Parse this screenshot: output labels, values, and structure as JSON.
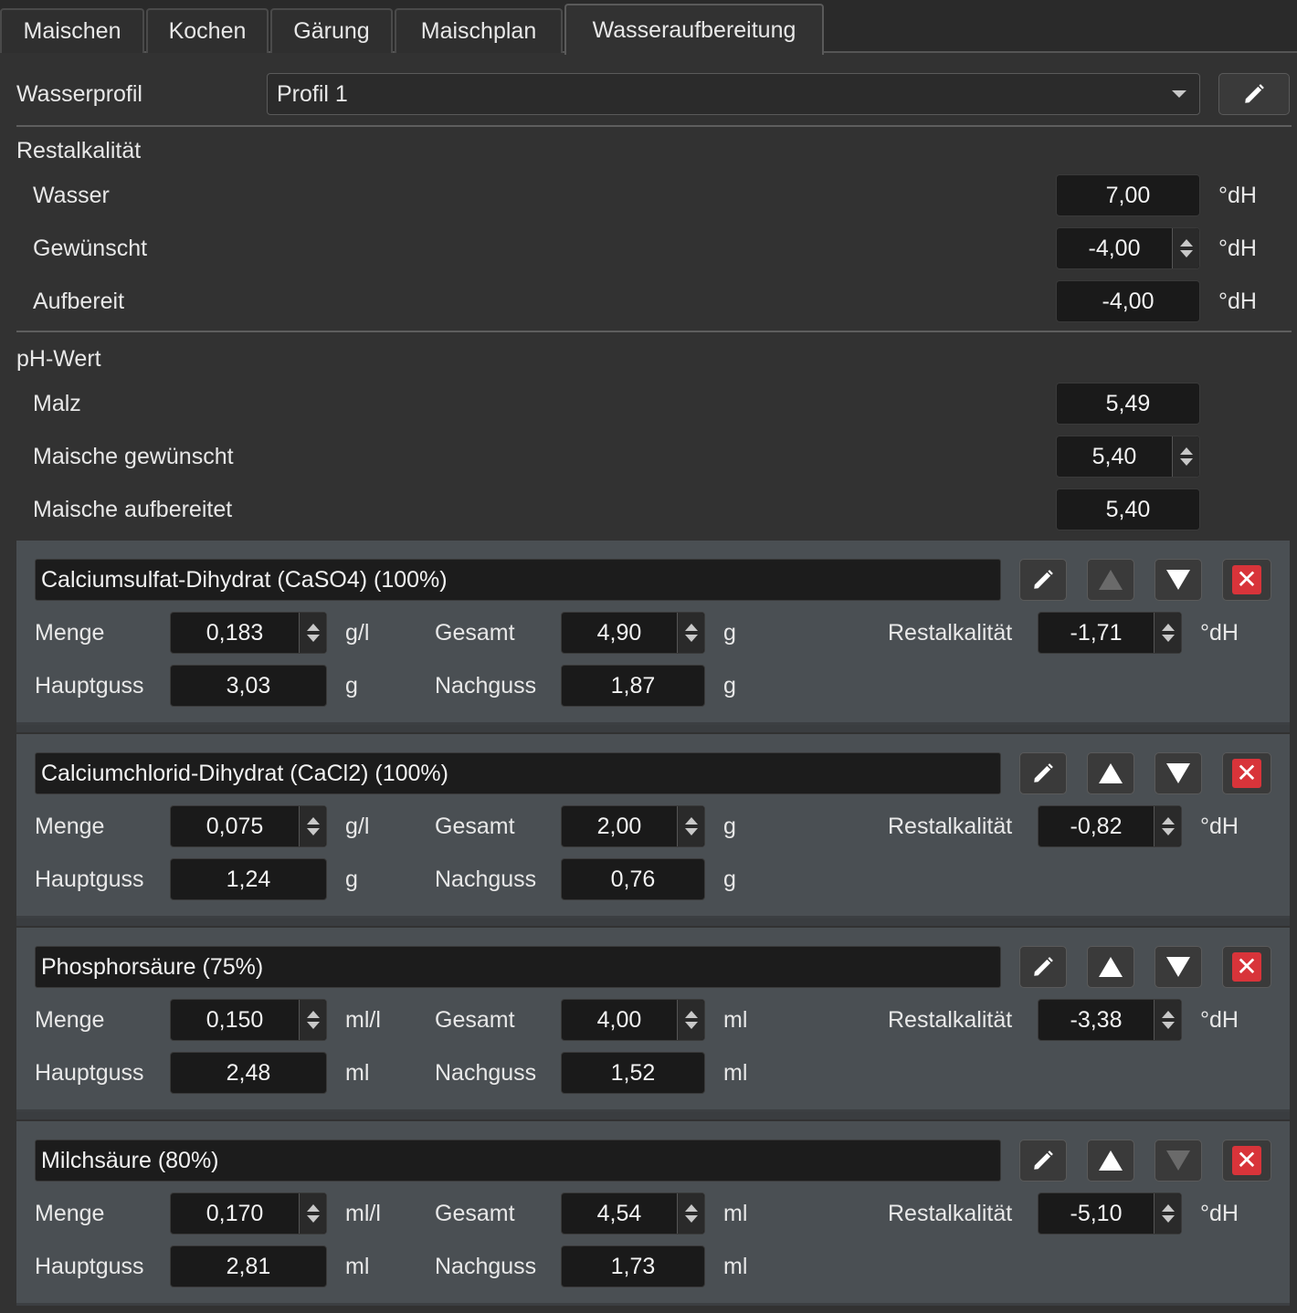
{
  "tabs": [
    "Maischen",
    "Kochen",
    "Gärung",
    "Maischplan",
    "Wasseraufbereitung"
  ],
  "profile": {
    "label": "Wasserprofil",
    "value": "Profil 1"
  },
  "restalkalitaet": {
    "heading": "Restalkalität",
    "rows": [
      {
        "label": "Wasser",
        "value": "7,00",
        "unit": "°dH"
      },
      {
        "label": "Gewünscht",
        "value": "-4,00",
        "unit": "°dH"
      },
      {
        "label": "Aufbereit",
        "value": "-4,00",
        "unit": "°dH"
      }
    ]
  },
  "ph": {
    "heading": "pH-Wert",
    "rows": [
      {
        "label": "Malz",
        "value": "5,49"
      },
      {
        "label": "Maische gewünscht",
        "value": "5,40"
      },
      {
        "label": "Maische aufbereitet",
        "value": "5,40"
      }
    ]
  },
  "field_labels": {
    "menge": "Menge",
    "gesamt": "Gesamt",
    "restalkalitaet": "Restalkalität",
    "hauptguss": "Hauptguss",
    "nachguss": "Nachguss",
    "ra_unit": "°dH"
  },
  "icons": {
    "edit": "pencil-icon",
    "up": "arrow-up-icon",
    "down": "arrow-down-icon",
    "delete": "close-icon"
  },
  "additives": [
    {
      "name": "Calciumsulfat-Dihydrat (CaSO4) (100%)",
      "menge": "0,183",
      "menge_unit": "g/l",
      "gesamt": "4,90",
      "gesamt_unit": "g",
      "restalkalitaet": "-1,71",
      "hauptguss": "3,03",
      "hauptguss_unit": "g",
      "nachguss": "1,87",
      "nachguss_unit": "g",
      "up_enabled": false,
      "down_enabled": true
    },
    {
      "name": "Calciumchlorid-Dihydrat (CaCl2) (100%)",
      "menge": "0,075",
      "menge_unit": "g/l",
      "gesamt": "2,00",
      "gesamt_unit": "g",
      "restalkalitaet": "-0,82",
      "hauptguss": "1,24",
      "hauptguss_unit": "g",
      "nachguss": "0,76",
      "nachguss_unit": "g",
      "up_enabled": true,
      "down_enabled": true
    },
    {
      "name": "Phosphorsäure (75%)",
      "menge": "0,150",
      "menge_unit": "ml/l",
      "gesamt": "4,00",
      "gesamt_unit": "ml",
      "restalkalitaet": "-3,38",
      "hauptguss": "2,48",
      "hauptguss_unit": "ml",
      "nachguss": "1,52",
      "nachguss_unit": "ml",
      "up_enabled": true,
      "down_enabled": true
    },
    {
      "name": "Milchsäure (80%)",
      "menge": "0,170",
      "menge_unit": "ml/l",
      "gesamt": "4,54",
      "gesamt_unit": "ml",
      "restalkalitaet": "-5,10",
      "hauptguss": "2,81",
      "hauptguss_unit": "ml",
      "nachguss": "1,73",
      "nachguss_unit": "ml",
      "up_enabled": true,
      "down_enabled": false
    }
  ]
}
